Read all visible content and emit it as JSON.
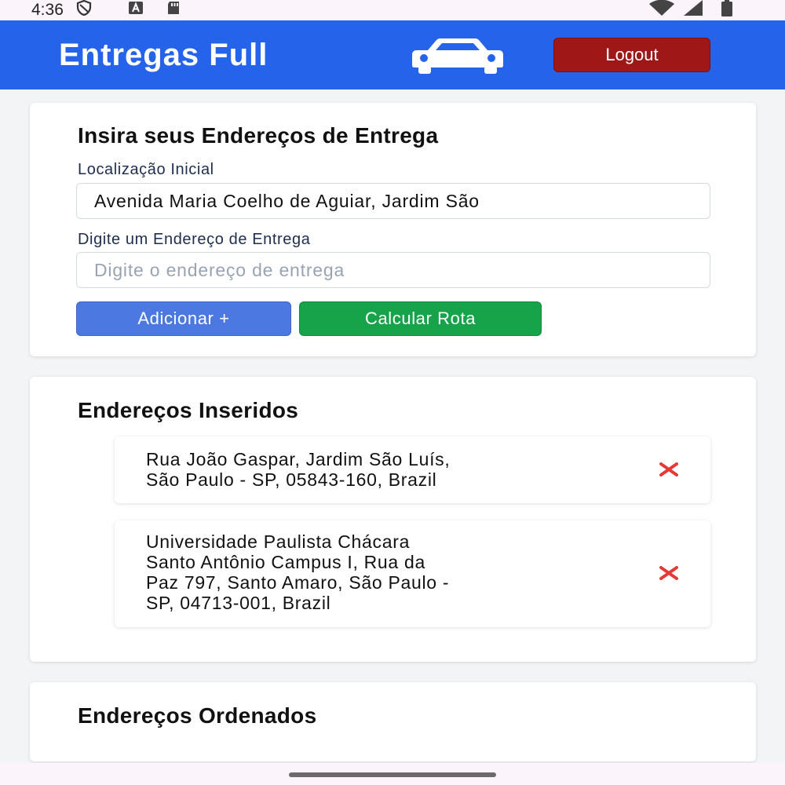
{
  "status_bar": {
    "time": "4:36",
    "left_icons": [
      "shield-icon",
      "a-notification-icon",
      "sd-card-icon"
    ],
    "right_icons": [
      "wifi-icon",
      "signal-icon",
      "battery-icon"
    ]
  },
  "header": {
    "title": "Entregas Full",
    "logo_icon": "car-icon",
    "logout_label": "Logout"
  },
  "form": {
    "title": "Insira seus Endereços de Entrega",
    "start_label": "Localização Inicial",
    "start_value": "Avenida Maria Coelho de Aguiar, Jardim São",
    "delivery_label": "Digite um Endereço de Entrega",
    "delivery_placeholder": "Digite o endereço de entrega",
    "add_label": "Adicionar +",
    "calc_label": "Calcular Rota"
  },
  "inserted": {
    "title": "Endereços Inseridos",
    "items": [
      {
        "lines": [
          "Rua João Gaspar, Jardim São Luís,",
          "São Paulo - SP, 05843-160, Brazil"
        ]
      },
      {
        "lines": [
          "Universidade Paulista Chácara",
          "Santo Antônio Campus I, Rua da",
          "Paz 797, Santo Amaro, São Paulo -",
          "SP, 04713-001, Brazil"
        ]
      }
    ],
    "remove_icon": "close-icon"
  },
  "ordered": {
    "title": "Endereços Ordenados"
  },
  "colors": {
    "appbar": "#2563eb",
    "logout": "#9f1717",
    "add_button": "#4c78e2",
    "calc_button": "#16a34a",
    "remove": "#e53935"
  }
}
